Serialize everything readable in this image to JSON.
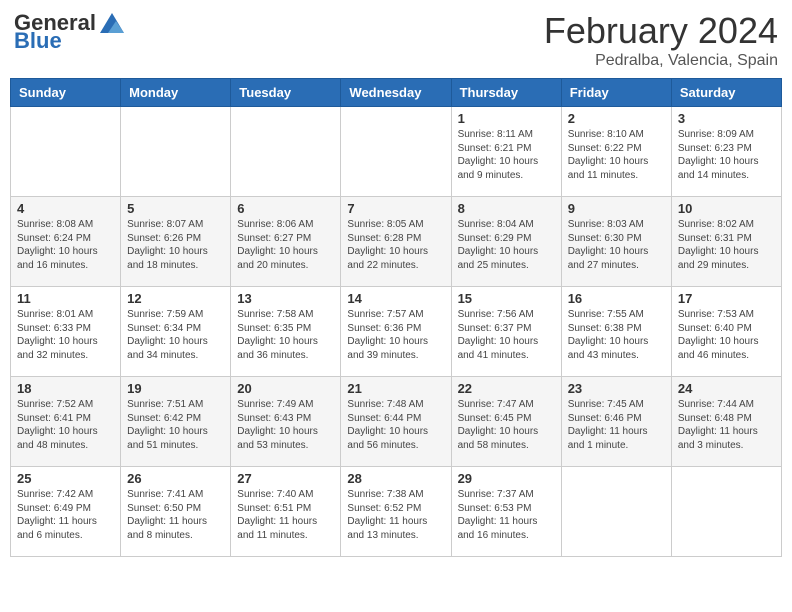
{
  "header": {
    "logo_general": "General",
    "logo_blue": "Blue",
    "title": "February 2024",
    "subtitle": "Pedralba, Valencia, Spain"
  },
  "weekdays": [
    "Sunday",
    "Monday",
    "Tuesday",
    "Wednesday",
    "Thursday",
    "Friday",
    "Saturday"
  ],
  "weeks": [
    [
      {
        "day": "",
        "info": ""
      },
      {
        "day": "",
        "info": ""
      },
      {
        "day": "",
        "info": ""
      },
      {
        "day": "",
        "info": ""
      },
      {
        "day": "1",
        "info": "Sunrise: 8:11 AM\nSunset: 6:21 PM\nDaylight: 10 hours\nand 9 minutes."
      },
      {
        "day": "2",
        "info": "Sunrise: 8:10 AM\nSunset: 6:22 PM\nDaylight: 10 hours\nand 11 minutes."
      },
      {
        "day": "3",
        "info": "Sunrise: 8:09 AM\nSunset: 6:23 PM\nDaylight: 10 hours\nand 14 minutes."
      }
    ],
    [
      {
        "day": "4",
        "info": "Sunrise: 8:08 AM\nSunset: 6:24 PM\nDaylight: 10 hours\nand 16 minutes."
      },
      {
        "day": "5",
        "info": "Sunrise: 8:07 AM\nSunset: 6:26 PM\nDaylight: 10 hours\nand 18 minutes."
      },
      {
        "day": "6",
        "info": "Sunrise: 8:06 AM\nSunset: 6:27 PM\nDaylight: 10 hours\nand 20 minutes."
      },
      {
        "day": "7",
        "info": "Sunrise: 8:05 AM\nSunset: 6:28 PM\nDaylight: 10 hours\nand 22 minutes."
      },
      {
        "day": "8",
        "info": "Sunrise: 8:04 AM\nSunset: 6:29 PM\nDaylight: 10 hours\nand 25 minutes."
      },
      {
        "day": "9",
        "info": "Sunrise: 8:03 AM\nSunset: 6:30 PM\nDaylight: 10 hours\nand 27 minutes."
      },
      {
        "day": "10",
        "info": "Sunrise: 8:02 AM\nSunset: 6:31 PM\nDaylight: 10 hours\nand 29 minutes."
      }
    ],
    [
      {
        "day": "11",
        "info": "Sunrise: 8:01 AM\nSunset: 6:33 PM\nDaylight: 10 hours\nand 32 minutes."
      },
      {
        "day": "12",
        "info": "Sunrise: 7:59 AM\nSunset: 6:34 PM\nDaylight: 10 hours\nand 34 minutes."
      },
      {
        "day": "13",
        "info": "Sunrise: 7:58 AM\nSunset: 6:35 PM\nDaylight: 10 hours\nand 36 minutes."
      },
      {
        "day": "14",
        "info": "Sunrise: 7:57 AM\nSunset: 6:36 PM\nDaylight: 10 hours\nand 39 minutes."
      },
      {
        "day": "15",
        "info": "Sunrise: 7:56 AM\nSunset: 6:37 PM\nDaylight: 10 hours\nand 41 minutes."
      },
      {
        "day": "16",
        "info": "Sunrise: 7:55 AM\nSunset: 6:38 PM\nDaylight: 10 hours\nand 43 minutes."
      },
      {
        "day": "17",
        "info": "Sunrise: 7:53 AM\nSunset: 6:40 PM\nDaylight: 10 hours\nand 46 minutes."
      }
    ],
    [
      {
        "day": "18",
        "info": "Sunrise: 7:52 AM\nSunset: 6:41 PM\nDaylight: 10 hours\nand 48 minutes."
      },
      {
        "day": "19",
        "info": "Sunrise: 7:51 AM\nSunset: 6:42 PM\nDaylight: 10 hours\nand 51 minutes."
      },
      {
        "day": "20",
        "info": "Sunrise: 7:49 AM\nSunset: 6:43 PM\nDaylight: 10 hours\nand 53 minutes."
      },
      {
        "day": "21",
        "info": "Sunrise: 7:48 AM\nSunset: 6:44 PM\nDaylight: 10 hours\nand 56 minutes."
      },
      {
        "day": "22",
        "info": "Sunrise: 7:47 AM\nSunset: 6:45 PM\nDaylight: 10 hours\nand 58 minutes."
      },
      {
        "day": "23",
        "info": "Sunrise: 7:45 AM\nSunset: 6:46 PM\nDaylight: 11 hours\nand 1 minute."
      },
      {
        "day": "24",
        "info": "Sunrise: 7:44 AM\nSunset: 6:48 PM\nDaylight: 11 hours\nand 3 minutes."
      }
    ],
    [
      {
        "day": "25",
        "info": "Sunrise: 7:42 AM\nSunset: 6:49 PM\nDaylight: 11 hours\nand 6 minutes."
      },
      {
        "day": "26",
        "info": "Sunrise: 7:41 AM\nSunset: 6:50 PM\nDaylight: 11 hours\nand 8 minutes."
      },
      {
        "day": "27",
        "info": "Sunrise: 7:40 AM\nSunset: 6:51 PM\nDaylight: 11 hours\nand 11 minutes."
      },
      {
        "day": "28",
        "info": "Sunrise: 7:38 AM\nSunset: 6:52 PM\nDaylight: 11 hours\nand 13 minutes."
      },
      {
        "day": "29",
        "info": "Sunrise: 7:37 AM\nSunset: 6:53 PM\nDaylight: 11 hours\nand 16 minutes."
      },
      {
        "day": "",
        "info": ""
      },
      {
        "day": "",
        "info": ""
      }
    ]
  ]
}
